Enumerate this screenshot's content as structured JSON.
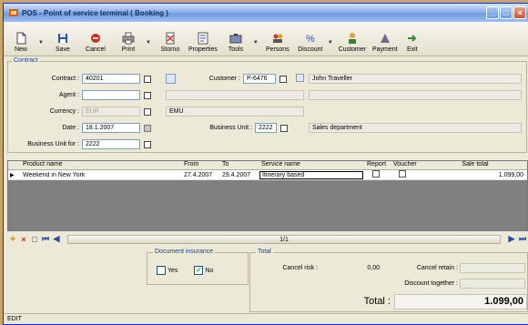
{
  "window": {
    "title": "POS - Point of service terminal ( Booking )"
  },
  "toolbar": {
    "buttons": [
      {
        "label": "New",
        "icon": "new-doc-icon",
        "dropdown": true
      },
      {
        "label": "Save",
        "icon": "floppy-icon",
        "dropdown": false
      },
      {
        "label": "Cancel",
        "icon": "cancel-icon",
        "dropdown": false
      },
      {
        "label": "Print",
        "icon": "printer-icon",
        "dropdown": true
      },
      {
        "label": "Storno",
        "icon": "storno-icon",
        "dropdown": false
      },
      {
        "label": "Properties",
        "icon": "properties-icon",
        "dropdown": false
      },
      {
        "label": "Tools",
        "icon": "tools-icon",
        "dropdown": true
      },
      {
        "label": "Persons",
        "icon": "persons-icon",
        "dropdown": false
      },
      {
        "label": "Discount",
        "icon": "discount-icon",
        "dropdown": true
      },
      {
        "label": "Customer",
        "icon": "customer-icon",
        "dropdown": false
      },
      {
        "label": "Payment",
        "icon": "payment-icon",
        "dropdown": false
      },
      {
        "label": "Exit",
        "icon": "exit-icon",
        "dropdown": false
      }
    ]
  },
  "contract": {
    "legend": "Contract",
    "contract_label": "Contract :",
    "contract_value": "40201",
    "agent_label": "Agent :",
    "agent_value": "",
    "currency_label": "Currency :",
    "currency_value": "EUR",
    "currency_name": "EMU",
    "date_label": "Date :",
    "date_value": "18.1.2007",
    "bu_for_label": "Business Unit for :",
    "bu_for_value": "2222",
    "customer_label": "Customer :",
    "customer_value": "P-6476",
    "customer_name": "John Traveller",
    "bu_label": "Business Unit :",
    "bu_value": "2222",
    "bu_name": "Sales department"
  },
  "grid": {
    "columns": [
      "Product name",
      "From",
      "To",
      "Service name",
      "Report",
      "Voucher",
      "Sale total"
    ],
    "rows": [
      {
        "product": "Weekend in New York",
        "from": "27.4.2007",
        "to": "29.4.2007",
        "service": "Itinerary based",
        "sale_total": "1.099,00"
      }
    ]
  },
  "nav": {
    "page": "1/1"
  },
  "insurance": {
    "legend": "Document insurance",
    "yes_label": "Yes",
    "no_label": "No"
  },
  "total": {
    "legend": "Total",
    "cancel_risk_label": "Cancel risk :",
    "cancel_risk_value": "0,00",
    "cancel_retain_label": "Cancel retain :",
    "discount_together_label": "Discount together :",
    "total_label": "Total :",
    "total_value": "1.099,00"
  },
  "status": {
    "mode": "EDIT"
  },
  "colors": {
    "title_gradient_top": "#d3e4fb",
    "title_gradient_bottom": "#6f9be2",
    "accent": "#2a4a9f"
  }
}
